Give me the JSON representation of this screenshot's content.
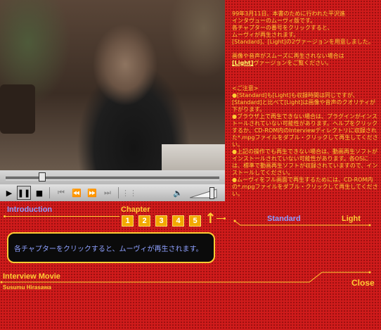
{
  "player": {
    "controls": [
      {
        "name": "play-icon",
        "glyph": "▶",
        "enabled": true
      },
      {
        "name": "pause-icon",
        "glyph": "❚❚",
        "enabled": true,
        "pressed": true
      },
      {
        "name": "stop-icon",
        "glyph": "■",
        "enabled": true
      },
      {
        "name": "skip-back-icon",
        "glyph": "⏮",
        "enabled": false
      },
      {
        "name": "rewind-icon",
        "glyph": "⏪",
        "enabled": false
      },
      {
        "name": "fast-forward-icon",
        "glyph": "⏩",
        "enabled": false
      },
      {
        "name": "skip-forward-icon",
        "glyph": "⏭",
        "enabled": false
      },
      {
        "name": "playlist-icon",
        "glyph": "⋮⋮",
        "enabled": false
      }
    ],
    "speaker_icon": "🔈",
    "seek_progress": 0.17,
    "volume": 0.78
  },
  "nav": {
    "intro_label": "Introduction",
    "chapter_label": "Chapter",
    "chapters": [
      "1",
      "2",
      "3",
      "4",
      "5"
    ],
    "up_glyph": "↑"
  },
  "message": {
    "text": "各チャプターをクリックすると、ムーヴィが再生されます。"
  },
  "footer": {
    "title": "Interview Movie",
    "subtitle": "Susumu Hirasawa",
    "close_label": "Close"
  },
  "versions": {
    "standard_label": "Standard",
    "light_label": "Light"
  },
  "info": {
    "intro_lines": [
      "99年3月11日、本書のために行われた平沢進",
      "インタヴューのムーヴィ版です。",
      "各チャプターの番号をクリックすると、",
      "ムーヴィが再生されます。",
      "[Standard]、[Light]の2ヴァージョンを用意しました。"
    ],
    "light_note_pre": "画像や音声がスムーズに再生されない場合は",
    "light_note_link": "[Light]",
    "light_note_post": "ヴァージョンをご覧ください。",
    "notes_heading": "<ご注意>",
    "notes": [
      "●[Standard]も[Light]も収録時間は同じですが、[Standard]と比べて[Light]は画像や音声のクオリティが下がります。",
      "●ブラウザ上で再生できない場合は、プラグインがインストールされていない可能性があります。ヘルプをクリックするか、CD-ROM内のInterviewディレクトリに収録された*.mpgファイルをダブル・クリックして再生してください。",
      "●上記の操作でも再生できない場合は、動画再生ソフトがインストールされていない可能性があります。各OSには、標準で動画再生ソフトが収録されていますので、インストールしてください。",
      "●ムーヴィをフル画面で再生するためには、CD-ROM内の*.mpgファイルをダブル・クリックして再生してください。"
    ]
  },
  "colors": {
    "background": "#cf1b1b",
    "accent_gold": "#ffcc33",
    "accent_blue": "#8a9cff",
    "chapter_button": "#f2a900"
  }
}
